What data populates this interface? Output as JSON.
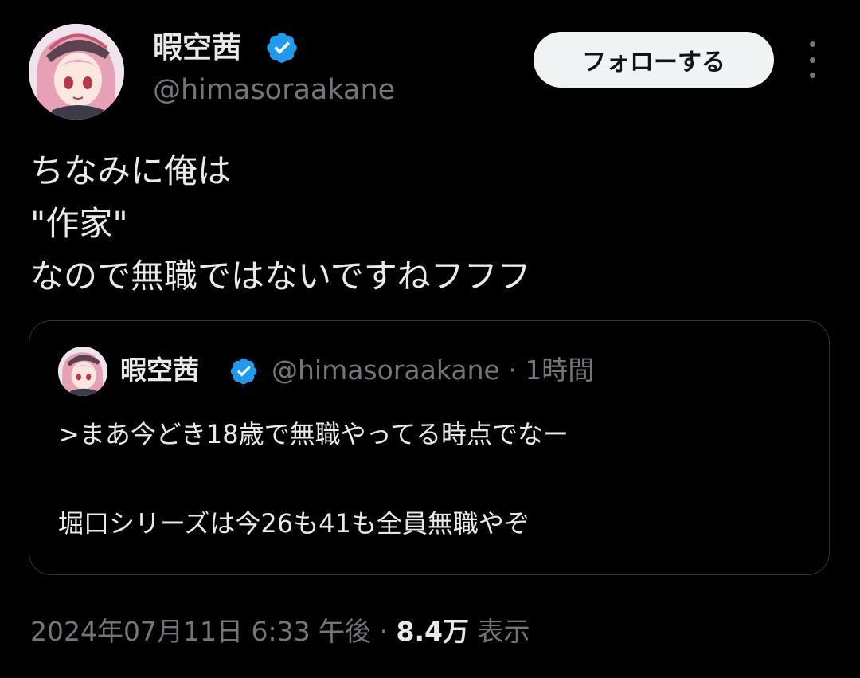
{
  "author": {
    "display_name": "暇空茜",
    "handle": "@himasoraakane",
    "verified": true
  },
  "follow_button_label": "フォローする",
  "more_icon": "more-vertical-icon",
  "tweet": {
    "lines": [
      "ちなみに俺は",
      "\"作家\"",
      "なので無職ではないですねフフフ"
    ]
  },
  "quoted_tweet": {
    "display_name": "暇空茜",
    "handle": "@himasoraakane",
    "separator": " · ",
    "time_ago": "1時間",
    "verified": true,
    "lines": [
      ">まあ今どき18歳で無職やってる時点でなー",
      "",
      "堀口シリーズは今26も41も全員無職やぞ"
    ]
  },
  "meta": {
    "timestamp": "2024年07月11日 6:33 午後",
    "separator": " · ",
    "views_count": "8.4万",
    "views_label": " 表示"
  },
  "colors": {
    "background": "#000000",
    "text_primary": "#e7e9ea",
    "text_secondary": "#71767b",
    "verified_blue": "#1d9bf0",
    "border": "#2f3336",
    "follow_button_bg": "#eff3f4"
  }
}
